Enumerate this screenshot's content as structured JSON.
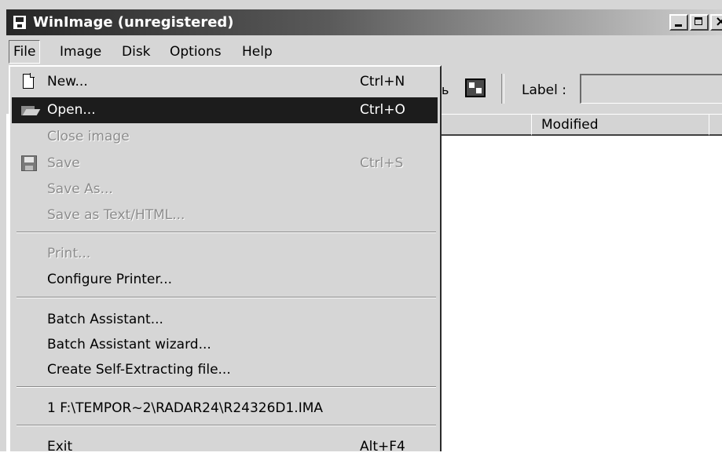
{
  "window": {
    "title": "WinImage (unregistered)"
  },
  "menubar": {
    "items": [
      {
        "label": "File"
      },
      {
        "label": "Image"
      },
      {
        "label": "Disk"
      },
      {
        "label": "Options"
      },
      {
        "label": "Help"
      }
    ]
  },
  "toolbar": {
    "partial_glyph": "ь",
    "label_caption": "Label :",
    "label_value": ""
  },
  "list": {
    "columns": [
      {
        "label": ""
      },
      {
        "label": "Modified"
      }
    ]
  },
  "file_menu": {
    "items": [
      {
        "label": "New...",
        "shortcut": "Ctrl+N",
        "icon": "new-file-icon",
        "state": "enabled"
      },
      {
        "label": "Open...",
        "shortcut": "Ctrl+O",
        "icon": "open-folder-icon",
        "state": "highlighted"
      },
      {
        "label": "Close image",
        "shortcut": "",
        "state": "disabled"
      },
      {
        "label": "Save",
        "shortcut": "Ctrl+S",
        "icon": "save-disk-icon",
        "state": "disabled"
      },
      {
        "label": "Save As...",
        "shortcut": "",
        "state": "disabled"
      },
      {
        "label": "Save as Text/HTML...",
        "shortcut": "",
        "state": "disabled"
      },
      {
        "label": "Print...",
        "shortcut": "",
        "state": "disabled"
      },
      {
        "label": "Configure Printer...",
        "shortcut": "",
        "state": "enabled"
      },
      {
        "label": "Batch Assistant...",
        "shortcut": "",
        "state": "enabled"
      },
      {
        "label": "Batch Assistant wizard...",
        "shortcut": "",
        "state": "enabled"
      },
      {
        "label": "Create Self-Extracting file...",
        "shortcut": "",
        "state": "enabled"
      },
      {
        "label": "1 F:\\TEMPOR~2\\RADAR24\\R24326D1.IMA",
        "shortcut": "",
        "state": "enabled"
      },
      {
        "label": "Exit",
        "shortcut": "Alt+F4",
        "state": "enabled"
      }
    ]
  },
  "colors": {
    "highlight": "#1c1c1c",
    "face": "#d6d6d6",
    "disabled_text": "#8c8c8c"
  }
}
